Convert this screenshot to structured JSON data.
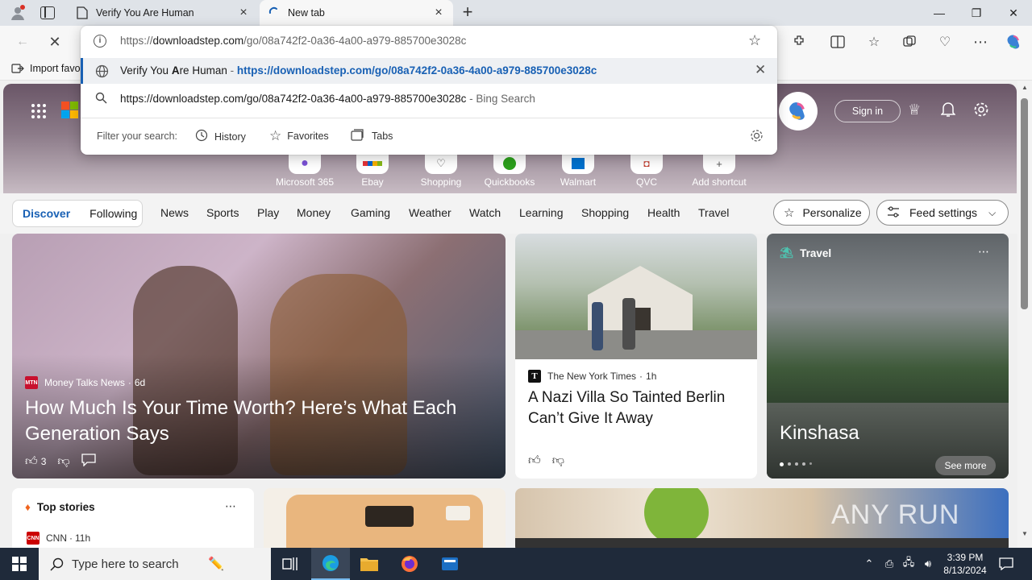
{
  "tabs": [
    {
      "label": "Verify You Are Human"
    },
    {
      "label": "New tab"
    }
  ],
  "window": {
    "minimize": "—",
    "restore": "❐",
    "close": "✕"
  },
  "omnibox": {
    "typed_url_prefix": "https://",
    "typed_url_domain": "downloadstep.com",
    "typed_url_path": "/go/08a742f2-0a36-4a00-a979-885700e3028c",
    "suggestion_title_pre": "Verify You ",
    "suggestion_title_bold": "A",
    "suggestion_title_post": "re Human",
    "suggestion_sep": " - ",
    "suggestion_url": "https://downloadstep.com/go/08a742f2-0a36-4a00-a979-885700e3028c",
    "search_query": "https://downloadstep.com/go/08a742f2-0a36-4a00-a979-885700e3028c",
    "search_engine": " - Bing Search",
    "filter_label": "Filter your search:",
    "filters": [
      "History",
      "Favorites",
      "Tabs"
    ]
  },
  "favbar": {
    "import_label": "Import favo"
  },
  "header": {
    "sign_in": "Sign in"
  },
  "shortcuts": [
    "Microsoft 365",
    "Ebay",
    "Shopping",
    "Quickbooks",
    "Walmart",
    "QVC",
    "Add shortcut"
  ],
  "feed_tabs": {
    "discover": "Discover",
    "following": "Following"
  },
  "nav": [
    "News",
    "Sports",
    "Play",
    "Money",
    "Gaming",
    "Weather",
    "Watch",
    "Learning",
    "Shopping",
    "Health",
    "Travel"
  ],
  "buttons": {
    "personalize": "Personalize",
    "feed_settings": "Feed settings"
  },
  "cards": {
    "main": {
      "source": "Money Talks News",
      "age": "6d",
      "title": "How Much Is Your Time Worth? Here’s What Each Generation Says",
      "likes": "3"
    },
    "nyt": {
      "source": "The New York Times",
      "age": "1h",
      "title": "A Nazi Villa So Tainted Berlin Can’t Give It Away"
    },
    "travel": {
      "category": "Travel",
      "place": "Kinshasa",
      "see_more": "See more"
    },
    "top_stories": {
      "label": "Top stories",
      "source": "CNN",
      "age": "11h"
    }
  },
  "taskbar": {
    "search_placeholder": "Type here to search",
    "time": "3:39 PM",
    "date": "8/13/2024"
  },
  "watermark": "ANY RUN",
  "colors": {
    "accent": "#1860b4",
    "taskbar": "#1f2a3a"
  }
}
